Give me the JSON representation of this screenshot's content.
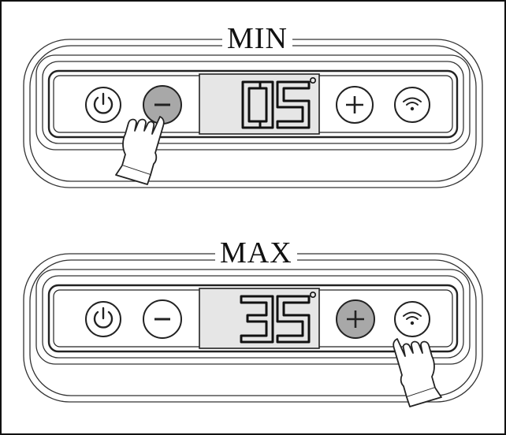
{
  "panels": [
    {
      "label": "MIN",
      "display_value": "05",
      "degree_symbol": "°",
      "pressed_button": "minus",
      "buttons": [
        "power",
        "minus",
        "plus",
        "wifi"
      ]
    },
    {
      "label": "MAX",
      "display_value": "35",
      "degree_symbol": "°",
      "pressed_button": "plus",
      "buttons": [
        "power",
        "minus",
        "plus",
        "wifi"
      ]
    }
  ],
  "icons": {
    "power": "power-icon",
    "minus": "minus-icon",
    "plus": "plus-icon",
    "wifi": "wifi-icon",
    "hand": "pointing-hand-icon"
  },
  "colors": {
    "outline": "#222222",
    "pressed_fill": "#a8a8a8",
    "display_fill": "#e6e6e6",
    "background": "#ffffff"
  }
}
